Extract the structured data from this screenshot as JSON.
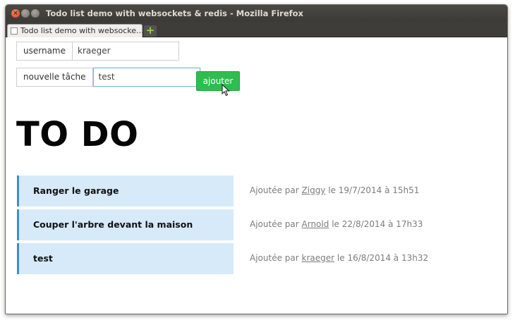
{
  "window": {
    "title": "Todo list demo with websockets & redis - Mozilla Firefox"
  },
  "tabs": [
    {
      "label": "Todo list demo with websocke…"
    }
  ],
  "form": {
    "username_label": "username",
    "username_value": "kraeger",
    "task_label": "nouvelle tâche",
    "task_value": "test",
    "submit_label": "ajouter"
  },
  "heading": "TO DO",
  "tasks": [
    {
      "text": "Ranger le garage",
      "prefix": "Ajoutée par",
      "author": "Ziggy",
      "suffix": "le 19/7/2014 à 15h51"
    },
    {
      "text": "Couper l'arbre devant la maison",
      "prefix": "Ajoutée par",
      "author": "Arnold",
      "suffix": "le 22/8/2014 à 17h33"
    },
    {
      "text": "test",
      "prefix": "Ajoutée par",
      "author": "kraeger",
      "suffix": "le 16/8/2014 à 13h32"
    }
  ],
  "colors": {
    "task_bg": "#d6eaf9",
    "task_accent": "#3a8fcf",
    "button_green": "#2ebd4f"
  }
}
